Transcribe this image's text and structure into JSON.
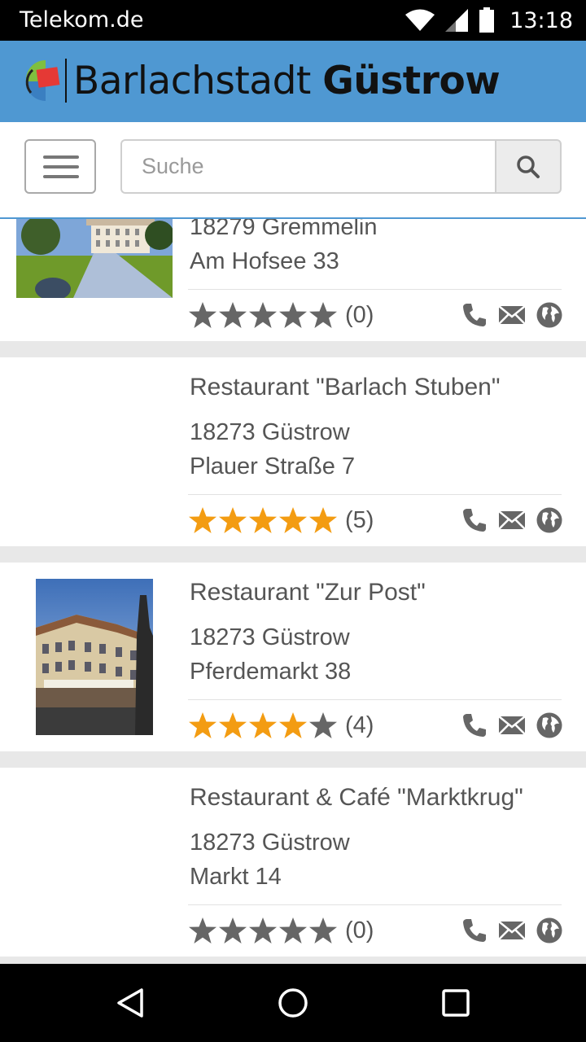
{
  "status_bar": {
    "carrier": "Telekom.de",
    "time": "13:18"
  },
  "header": {
    "title_regular": "Barlachstadt",
    "title_bold": "Güstrow"
  },
  "search": {
    "placeholder": "Suche",
    "value": ""
  },
  "colors": {
    "header_bg": "#4f98d2",
    "star_filled": "#f39c12",
    "star_empty": "#666666",
    "icon": "#666666"
  },
  "listings": [
    {
      "name": "",
      "zip_city": "18279 Gremmelin",
      "street": "Am Hofsee 33",
      "rating": 0,
      "rating_count": "(0)",
      "image": "manor-house-photo"
    },
    {
      "name": "Restaurant \"Barlach Stuben\"",
      "zip_city": "18273 Güstrow",
      "street": "Plauer Straße 7",
      "rating": 5,
      "rating_count": "(5)",
      "image": ""
    },
    {
      "name": "Restaurant \"Zur Post\"",
      "zip_city": "18273 Güstrow",
      "street": "Pferdemarkt 38",
      "rating": 4,
      "rating_count": "(4)",
      "image": "building-photo"
    },
    {
      "name": "Restaurant & Café \"Marktkrug\"",
      "zip_city": "18273 Güstrow",
      "street": "Markt 14",
      "rating": 0,
      "rating_count": "(0)",
      "image": ""
    }
  ]
}
